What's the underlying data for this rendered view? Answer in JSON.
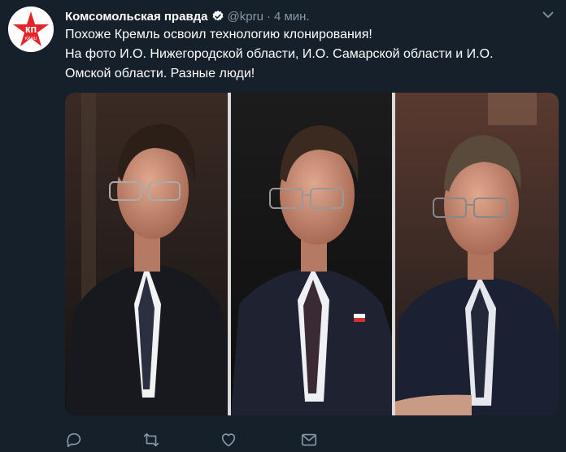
{
  "tweet": {
    "author_name": "Комсомольская правда",
    "handle": "@kpru",
    "separator": "·",
    "time": "4 мин.",
    "text_lines": [
      "Похоже Кремль освоил технологию клонирования!",
      "На фото И.О. Нижегородской области, И.О. Самарской области и И.О.",
      "Омской области. Разные люди!"
    ],
    "avatar_logo": "кп",
    "avatar_sub": "KP.RU"
  },
  "icons": {
    "verified": "verified-badge-icon",
    "menu": "chevron-down-icon",
    "reply": "reply-icon",
    "retweet": "retweet-icon",
    "like": "heart-icon",
    "dm": "envelope-icon"
  },
  "colors": {
    "background": "#15202b",
    "secondary_text": "#8899a6",
    "brand_red": "#e3262b",
    "verified_blue": "#ffffff"
  }
}
